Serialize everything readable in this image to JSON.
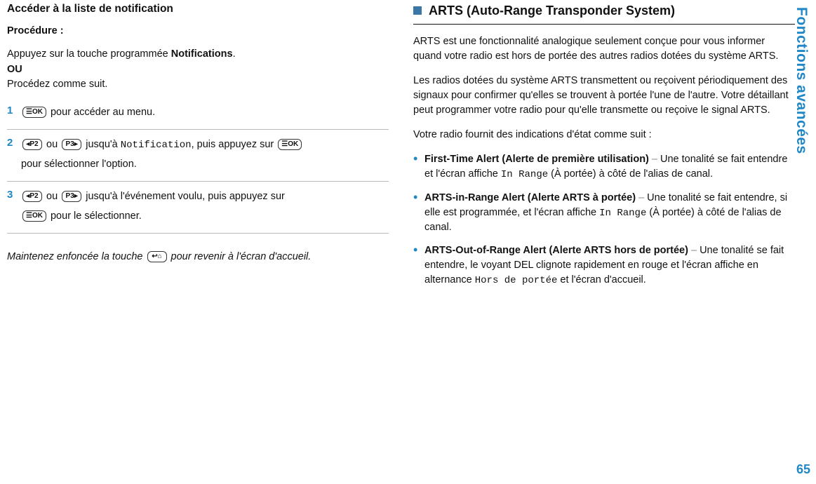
{
  "sideLabel": "Fonctions avancées",
  "pageNumber": "65",
  "left": {
    "heading": "Accéder à la liste de notification",
    "procLabel": "Procédure :",
    "intro1a": "Appuyez sur la touche programmée ",
    "intro1b": "Notifications",
    "intro1c": ".",
    "intro2a": "OU",
    "intro2b": "Procédez comme suit.",
    "step1": {
      "k1": "☰OK",
      "text": " pour accéder au menu."
    },
    "step2": {
      "k1": "◂P2",
      "or": " ou ",
      "k2": "P3▸",
      "t1": " jusqu'à ",
      "code1": "Notification",
      "t2": ", puis appuyez sur ",
      "k3": "☰OK",
      "t3": "pour sélectionner l'option."
    },
    "step3": {
      "k1": "◂P2",
      "or": " ou ",
      "k2": "P3▸",
      "t1": " jusqu'à l'événement voulu, puis appuyez sur",
      "k3": "☰OK",
      "t2": " pour le sélectionner."
    },
    "homeNote": {
      "a": "Maintenez enfoncée la touche ",
      "key": "↩⌂",
      "b": " pour revenir à l'écran d'accueil."
    }
  },
  "right": {
    "sectionTitle": "ARTS (Auto-Range Transponder System)",
    "p1": "ARTS est une fonctionnalité analogique seulement conçue pour vous informer quand votre radio est hors de portée des autres radios dotées du système ARTS.",
    "p2": "Les radios dotées du système ARTS transmettent ou reçoivent périodiquement des signaux pour confirmer qu'elles se trouvent à portée l'une de l'autre. Votre détaillant peut programmer votre radio pour qu'elle transmette ou reçoive le signal ARTS.",
    "p3": "Votre radio fournit des indications d'état comme suit :",
    "items": [
      {
        "bold": "First-Time Alert (Alerte de première utilisation)",
        "dash": " – ",
        "t1": "Une tonalité se fait entendre et l'écran affiche ",
        "code": "In Range",
        "t2": " (À portée) à côté de l'alias de canal."
      },
      {
        "bold": "ARTS-in-Range Alert (Alerte ARTS à portée)",
        "dash": " – ",
        "t1": "Une tonalité se fait entendre, si elle est programmée, et l'écran affiche ",
        "code": "In Range",
        "t2": " (À portée) à côté de l'alias de canal."
      },
      {
        "bold": "ARTS-Out-of-Range Alert (Alerte ARTS hors de portée)",
        "dash": " – ",
        "t1": "Une tonalité se fait entendre, le voyant DEL clignote rapidement en rouge et l'écran affiche en alternance ",
        "code": "Hors de portée",
        "t2": " et l'écran d'accueil."
      }
    ]
  }
}
